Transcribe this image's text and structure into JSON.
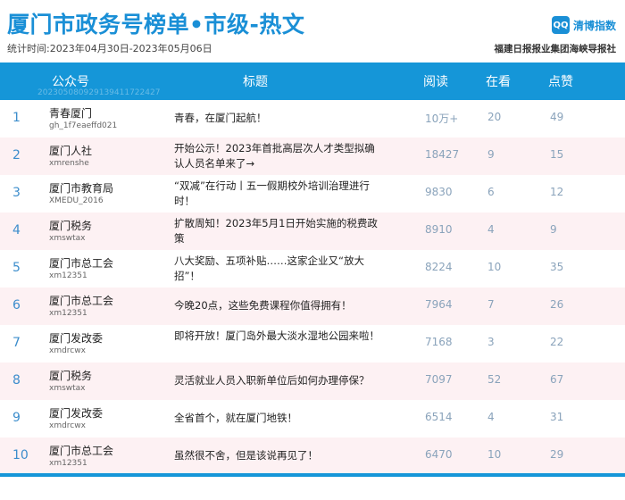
{
  "header": {
    "title": "厦门市政务号榜单•市级-热文",
    "period": "统计时间:2023年04月30日-2023年05月06日",
    "brand_logo": "QQ",
    "brand_name": "清博指数",
    "publisher": "福建日报报业集团海峡导报社"
  },
  "table": {
    "columns": {
      "account": "公众号",
      "title": "标题",
      "reads": "阅读",
      "watching": "在看",
      "likes": "点赞"
    },
    "header_id": "20230508092913941172242​7",
    "rows": [
      {
        "rank": "1",
        "name": "青春厦门",
        "id": "gh_1f7eaeffd021",
        "title": "青春，在厦门起航！",
        "reads": "10万+",
        "watching": "20",
        "likes": "49"
      },
      {
        "rank": "2",
        "name": "厦门人社",
        "id": "xmrenshe",
        "title": "开始公示！2023年首批高层次人才类型拟确认人员名单来了→",
        "reads": "18427",
        "watching": "9",
        "likes": "15"
      },
      {
        "rank": "3",
        "name": "厦门市教育局",
        "id": "XMEDU_2016",
        "title": "“双减”在行动丨五一假期校外培训治理进行时！",
        "reads": "9830",
        "watching": "6",
        "likes": "12"
      },
      {
        "rank": "4",
        "name": "厦门税务",
        "id": "xmswtax",
        "title": "扩散周知！2023年5月1日开始实施的税费政策",
        "reads": "8910",
        "watching": "4",
        "likes": "9"
      },
      {
        "rank": "5",
        "name": "厦门市总工会",
        "id": "xm12351",
        "title": "八大奖励、五项补贴……这家企业又“放大招”！",
        "reads": "8224",
        "watching": "10",
        "likes": "35"
      },
      {
        "rank": "6",
        "name": "厦门市总工会",
        "id": "xm12351",
        "title": "今晚20点，这些免费课程你值得拥有！",
        "reads": "7964",
        "watching": "7",
        "likes": "26"
      },
      {
        "rank": "7",
        "name": "厦门发改委",
        "id": "xmdrcwx",
        "title": "即将开放！厦门岛外最大淡水湿地公园来啦！",
        "reads": "7168",
        "watching": "3",
        "likes": "22"
      },
      {
        "rank": "8",
        "name": "厦门税务",
        "id": "xmswtax",
        "title": "灵活就业人员入职新单位后如何办理停保？",
        "reads": "7097",
        "watching": "52",
        "likes": "67"
      },
      {
        "rank": "9",
        "name": "厦门发改委",
        "id": "xmdrcwx",
        "title": "全省首个，就在厦门地铁！",
        "reads": "6514",
        "watching": "4",
        "likes": "31"
      },
      {
        "rank": "10",
        "name": "厦门市总工会",
        "id": "xm12351",
        "title": "虽然很不舍，但是该说再见了！",
        "reads": "6470",
        "watching": "10",
        "likes": "29"
      }
    ]
  },
  "colors": {
    "accent": "#1596d8",
    "title": "#1a8fd6",
    "row_alt": "#fdf1f3",
    "number": "#8aa3bb"
  }
}
